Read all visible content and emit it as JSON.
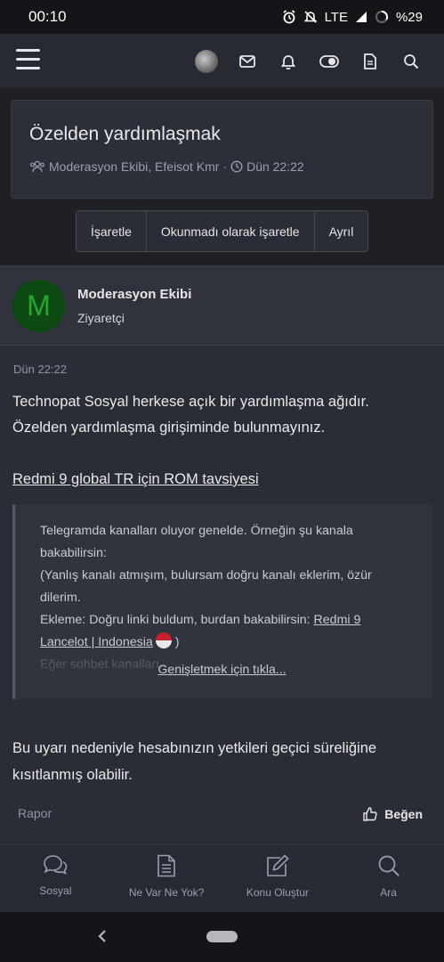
{
  "status_bar": {
    "time": "00:10",
    "network": "LTE",
    "battery": "%29"
  },
  "topnav": {
    "icons": [
      "menu-icon",
      "avatar",
      "mail-icon",
      "bell-icon",
      "toggle-icon",
      "document-icon",
      "search-icon"
    ]
  },
  "thread": {
    "title": "Özelden yardımlaşmak",
    "participants": "Moderasyon Ekibi, Efeisot Kmr",
    "separator": "·",
    "date": "Dün 22:22"
  },
  "actions": [
    "İşaretle",
    "Okunmadı olarak işaretle",
    "Ayrıl"
  ],
  "post": {
    "avatar_letter": "M",
    "author": "Moderasyon Ekibi",
    "author_role": "Ziyaretçi",
    "date": "Dün 22:22",
    "body_line1": "Technopat Sosyal herkese açık bir yardımlaşma ağıdır.",
    "body_line2": "Özelden yardımlaşma girişiminde bulunmayınız.",
    "link_text": "Redmi 9 global TR için ROM tavsiyesi",
    "quote": {
      "line1": "Telegramda kanalları oluyor genelde. Örneğin şu kanala",
      "line2": "bakabilirsin:",
      "line3": "(Yanlış kanalı atmışım, bulursam doğru kanalı eklerim, özür",
      "line4": "dilerim.",
      "line5_prefix": "Ekleme: Doğru linki buldum, burdan bakabilirsin: ",
      "line5_link": "Redmi 9",
      "line6_link": "Lancelot | Indonesia",
      "line6_suffix": " )",
      "line7_faded": "Eğer sohbet kanalları...",
      "expand_label": "Genişletmek için tıkla..."
    },
    "warning_line1": "Bu uyarı nedeniyle hesabınızın yetkileri geçici süreliğine",
    "warning_line2": "kısıtlanmış olabilir.",
    "report_label": "Rapor",
    "like_label": "Beğen"
  },
  "tabbar": [
    {
      "label": "Sosyal",
      "icon": "chat-bubbles-icon"
    },
    {
      "label": "Ne Var Ne Yok?",
      "icon": "document-icon"
    },
    {
      "label": "Konu Oluştur",
      "icon": "edit-icon"
    },
    {
      "label": "Ara",
      "icon": "search-icon"
    }
  ]
}
